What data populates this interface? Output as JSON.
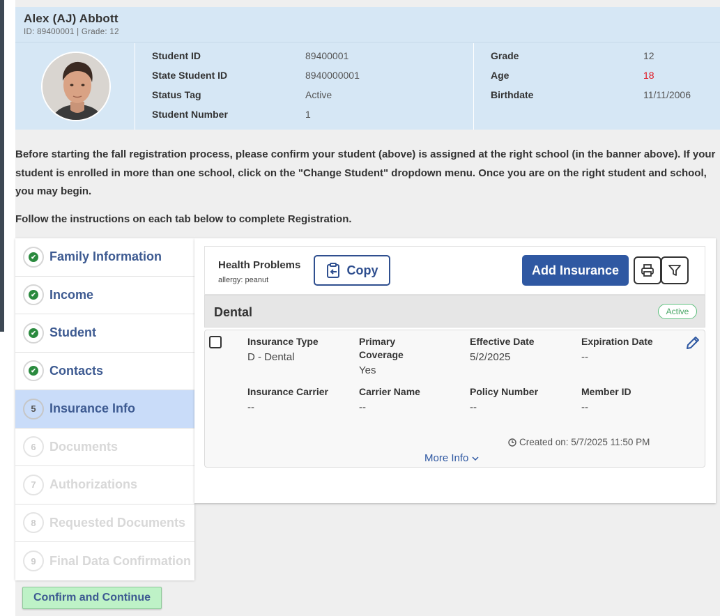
{
  "student": {
    "name": "Alex (AJ) Abbott",
    "sub": "ID: 89400001 |  Grade: 12",
    "fields_left": [
      {
        "label": "Student ID",
        "value": "89400001"
      },
      {
        "label": "State Student ID",
        "value": "8940000001"
      },
      {
        "label": "Status Tag",
        "value": "Active"
      },
      {
        "label": "Student Number",
        "value": "1"
      }
    ],
    "fields_right": [
      {
        "label": "Grade",
        "value": "12"
      },
      {
        "label": "Age",
        "value": "18"
      },
      {
        "label": "Birthdate",
        "value": "11/11/2006"
      }
    ]
  },
  "instructions": {
    "line1": "Before starting the fall registration process, please confirm your student (above) is assigned at the right school (in the banner above). If your student is enrolled in more than one school, click on the \"Change Student\" dropdown menu. Once you are on the right student and school, you may begin.",
    "line2": "Follow the instructions on each tab below to complete Registration."
  },
  "steps": [
    {
      "num": "",
      "label": "Family Information",
      "state": "done"
    },
    {
      "num": "",
      "label": "Income",
      "state": "done"
    },
    {
      "num": "",
      "label": "Student",
      "state": "done"
    },
    {
      "num": "",
      "label": "Contacts",
      "state": "done"
    },
    {
      "num": "5",
      "label": "Insurance Info",
      "state": "active"
    },
    {
      "num": "6",
      "label": "Documents",
      "state": "disabled"
    },
    {
      "num": "7",
      "label": "Authorizations",
      "state": "disabled"
    },
    {
      "num": "8",
      "label": "Requested Documents",
      "state": "disabled"
    },
    {
      "num": "9",
      "label": "Final Data Confirmation",
      "state": "disabled"
    }
  ],
  "confirm_label": "Confirm and Continue",
  "toolbar": {
    "health_title": "Health Problems",
    "health_sub": "allergy: peanut",
    "copy_label": "Copy",
    "add_label": "Add Insurance",
    "print_icon": "printer-icon",
    "filter_icon": "filter-icon"
  },
  "section": {
    "title": "Dental",
    "badge": "Active"
  },
  "record": {
    "fields": [
      {
        "label": "Insurance Type",
        "value": "D - Dental"
      },
      {
        "label": "Primary Coverage",
        "value": "Yes"
      },
      {
        "label": "Effective Date",
        "value": "5/2/2025"
      },
      {
        "label": "Expiration Date",
        "value": "--"
      },
      {
        "label": "Insurance Carrier",
        "value": "--"
      },
      {
        "label": "Carrier Name",
        "value": "--"
      },
      {
        "label": "Policy Number",
        "value": "--"
      },
      {
        "label": "Member ID",
        "value": "--"
      }
    ],
    "created": "Created on: 5/7/2025 11:50 PM",
    "more": "More Info"
  },
  "colors": {
    "accent": "#2f58a2",
    "banner": "#d6e7f5",
    "success": "#2a8a3e",
    "age_alert": "#e0141e"
  }
}
